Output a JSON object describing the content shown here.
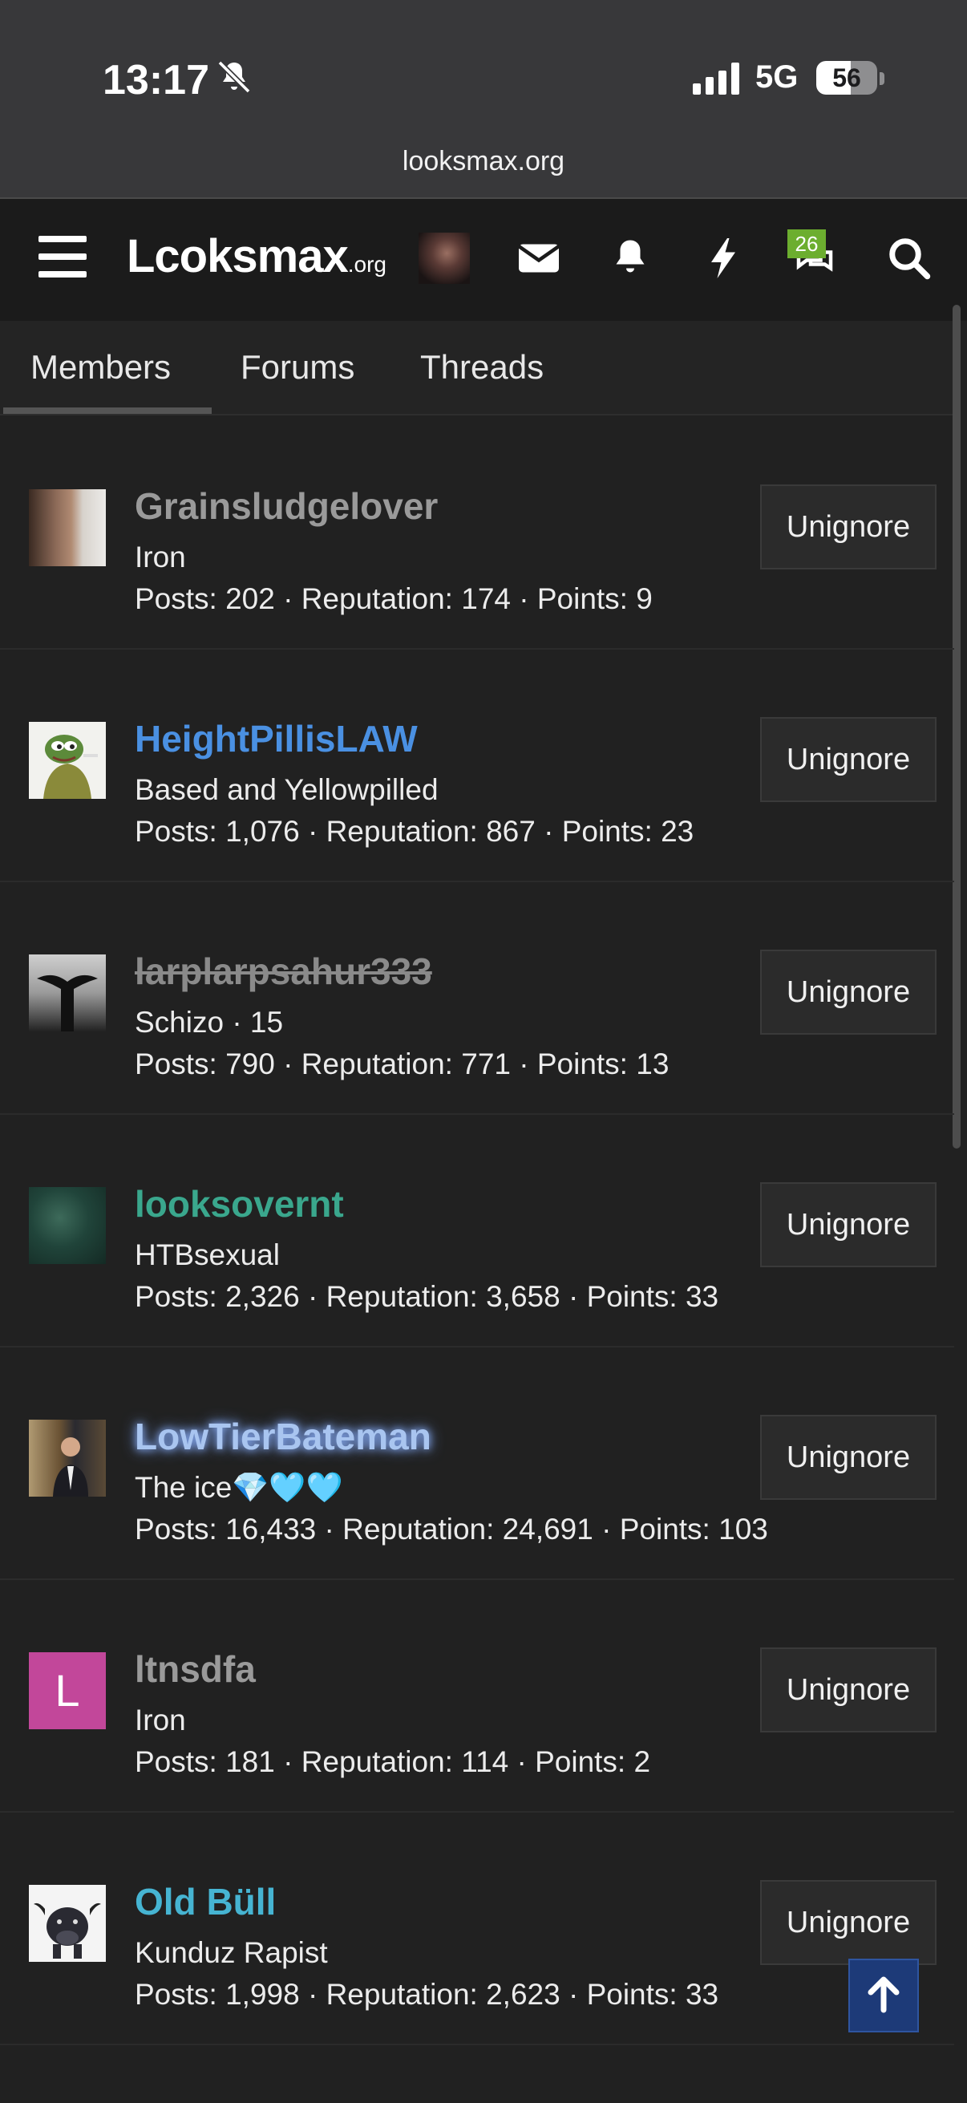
{
  "status_bar": {
    "time": "13:17",
    "network": "5G",
    "battery": "56",
    "battery_level": 0.56
  },
  "browser": {
    "url": "looksmax.org"
  },
  "header": {
    "logo_main": "Lcoksmax",
    "logo_suffix": ".org",
    "alerts_badge": "26"
  },
  "tabs": [
    {
      "label": "Members",
      "active": true
    },
    {
      "label": "Forums",
      "active": false
    },
    {
      "label": "Threads",
      "active": false
    }
  ],
  "members": [
    {
      "name": "Grainsludgelover",
      "name_color": "#9a9a9a",
      "title": "Iron",
      "stats": "Posts: 202 · Reputation: 174 · Points: 9",
      "action": "Unignore"
    },
    {
      "name": "HeightPillisLAW",
      "name_color": "#4a90e2",
      "title": "Based and Yellowpilled",
      "stats": "Posts: 1,076 · Reputation: 867 · Points: 23",
      "action": "Unignore"
    },
    {
      "name": "larplarpsahur333",
      "name_color": "#8a8a8a",
      "title": "Schizo · 15",
      "stats": "Posts: 790 · Reputation: 771 · Points: 13",
      "action": "Unignore"
    },
    {
      "name": "looksovernt",
      "name_color": "#3aa78d",
      "title": "HTBsexual",
      "stats": "Posts: 2,326 · Reputation: 3,658 · Points: 33",
      "action": "Unignore"
    },
    {
      "name": "LowTierBateman",
      "name_color": "#a9c5f0",
      "title": "The ice💎🩵🩵",
      "stats": "Posts: 16,433 · Reputation: 24,691 · Points: 103",
      "action": "Unignore"
    },
    {
      "name": "ltnsdfa",
      "name_color": "#9a9a9a",
      "title": "Iron",
      "stats": "Posts: 181 · Reputation: 114 · Points: 2",
      "action": "Unignore",
      "avatar_letter": "L"
    },
    {
      "name": "Old Büll",
      "name_color": "#46b4d2",
      "title": "Kunduz Rapist",
      "stats": "Posts: 1,998 · Reputation: 2,623 · Points: 33",
      "action": "Unignore"
    }
  ]
}
